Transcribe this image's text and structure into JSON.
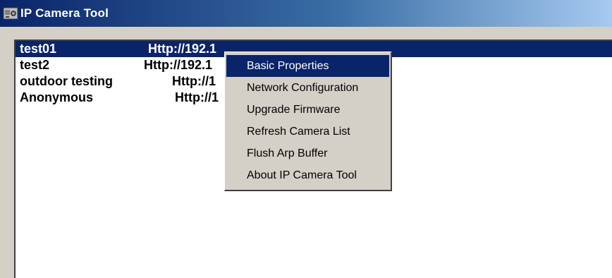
{
  "window": {
    "title": "IP Camera Tool",
    "icon": "ip-camera-tool-app-icon"
  },
  "cameras": [
    {
      "name": "test01",
      "url": "Http://192.1",
      "selected": true
    },
    {
      "name": "test2",
      "url": "Http://192.1",
      "selected": false
    },
    {
      "name": "outdoor testing",
      "url": "Http://1",
      "selected": false
    },
    {
      "name": "Anonymous",
      "url": "Http://1",
      "selected": false
    }
  ],
  "context_menu": {
    "items": [
      {
        "label": "Basic Properties",
        "highlighted": true
      },
      {
        "label": "Network Configuration",
        "highlighted": false
      },
      {
        "label": "Upgrade Firmware",
        "highlighted": false
      },
      {
        "label": "Refresh Camera List",
        "highlighted": false
      },
      {
        "label": "Flush Arp Buffer",
        "highlighted": false
      },
      {
        "label": "About IP Camera Tool",
        "highlighted": false
      }
    ]
  },
  "colors": {
    "selection": "#0a246a",
    "face": "#d4d0c8"
  }
}
